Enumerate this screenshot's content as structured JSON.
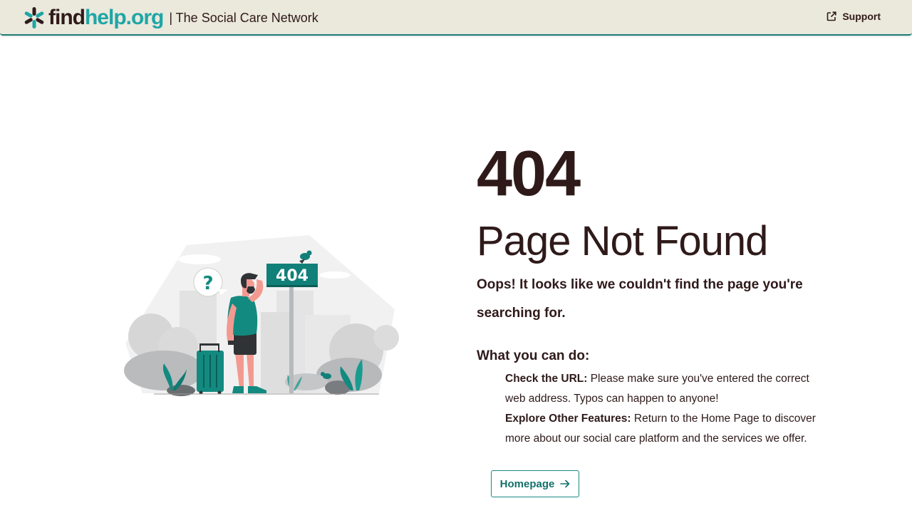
{
  "header": {
    "logo": {
      "find": "find",
      "help": "help",
      "org": ".org"
    },
    "tagline": "| The Social Care Network",
    "support_label": "Support"
  },
  "illustration": {
    "sign_text": "404",
    "bubble_text": "?"
  },
  "main": {
    "code": "404",
    "title": "Page Not Found",
    "message": "Oops! It looks like we couldn't find the page you're searching for.",
    "what_heading": "What you can do:",
    "tips": [
      {
        "label": "Check the URL:",
        "text": " Please make sure you've entered the correct web address. Typos can happen to anyone!"
      },
      {
        "label": "Explore Other Features:",
        "text": " Return to the Home Page to discover more about our social care platform and the services we offer."
      }
    ],
    "home_button": "Homepage"
  },
  "colors": {
    "teal": "#1fa6a6",
    "dark_teal": "#13706a",
    "brown": "#2f1a1a",
    "header_bg": "#ebe8dc"
  }
}
